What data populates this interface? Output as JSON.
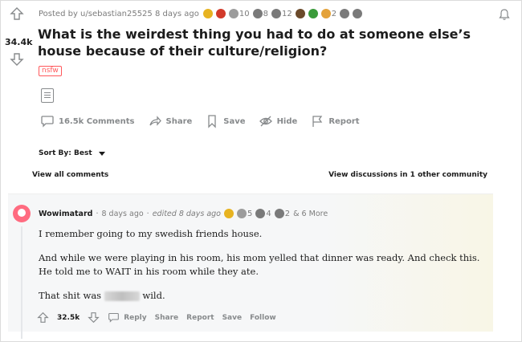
{
  "post": {
    "score": "34.4k",
    "posted_by": "Posted by u/sebastian25525 8 days ago",
    "awards": [
      {
        "icon": "gold-award-icon",
        "color": "#e7b321",
        "count": ""
      },
      {
        "icon": "fire-award-icon",
        "color": "#d23a2a",
        "count": ""
      },
      {
        "icon": "wholesome-award-icon",
        "color": "#9c9c9c",
        "count": "10"
      },
      {
        "icon": "helpful-award-icon",
        "color": "#7a7a7a",
        "count": "8"
      },
      {
        "icon": "silver-award-icon",
        "color": "#7a7a7a",
        "count": "12"
      },
      {
        "icon": "bear-award-icon",
        "color": "#6b4a2a",
        "count": ""
      },
      {
        "icon": "parrot-award-icon",
        "color": "#3a9a3a",
        "count": ""
      },
      {
        "icon": "heart-eyes-award-icon",
        "color": "#e4a23a",
        "count": "2"
      },
      {
        "icon": "bird-award-icon",
        "color": "#7a7a7a",
        "count": ""
      },
      {
        "icon": "cat-award-icon",
        "color": "#7a7a7a",
        "count": ""
      }
    ],
    "title": "What is the weirdest thing you had to do at someone else’s house because of their culture/religion?",
    "nsfw_label": "nsfw",
    "actions": {
      "comments": "16.5k Comments",
      "share": "Share",
      "save": "Save",
      "hide": "Hide",
      "report": "Report"
    }
  },
  "sort": {
    "label": "Sort By: Best"
  },
  "links": {
    "view_all": "View all comments",
    "view_other": "View discussions in 1 other community"
  },
  "comment": {
    "username": "Wowimatard",
    "time": "8 days ago",
    "edited": "edited 8 days ago",
    "awards": [
      {
        "icon": "gold-award-icon",
        "color": "#e7b321",
        "count": ""
      },
      {
        "icon": "wholesome-award-icon",
        "color": "#9c9c9c",
        "count": "5"
      },
      {
        "icon": "helpful-award-icon",
        "color": "#7a7a7a",
        "count": "4"
      },
      {
        "icon": "silver-award-icon",
        "color": "#7a7a7a",
        "count": "2"
      }
    ],
    "more_awards": "& 6 More",
    "paragraphs": [
      "I remember going to my swedish friends house.",
      "And while we were playing in his room, his mom yelled that dinner was ready. And check this. He told me to WAIT in his room while they ate.",
      "That shit was",
      "wild."
    ],
    "score": "32.5k",
    "actions": {
      "reply": "Reply",
      "share": "Share",
      "report": "Report",
      "save": "Save",
      "follow": "Follow"
    }
  },
  "colors": {
    "accent_red": "#ff585b",
    "avatar": "#ff6b80",
    "muted": "#878a8c"
  }
}
